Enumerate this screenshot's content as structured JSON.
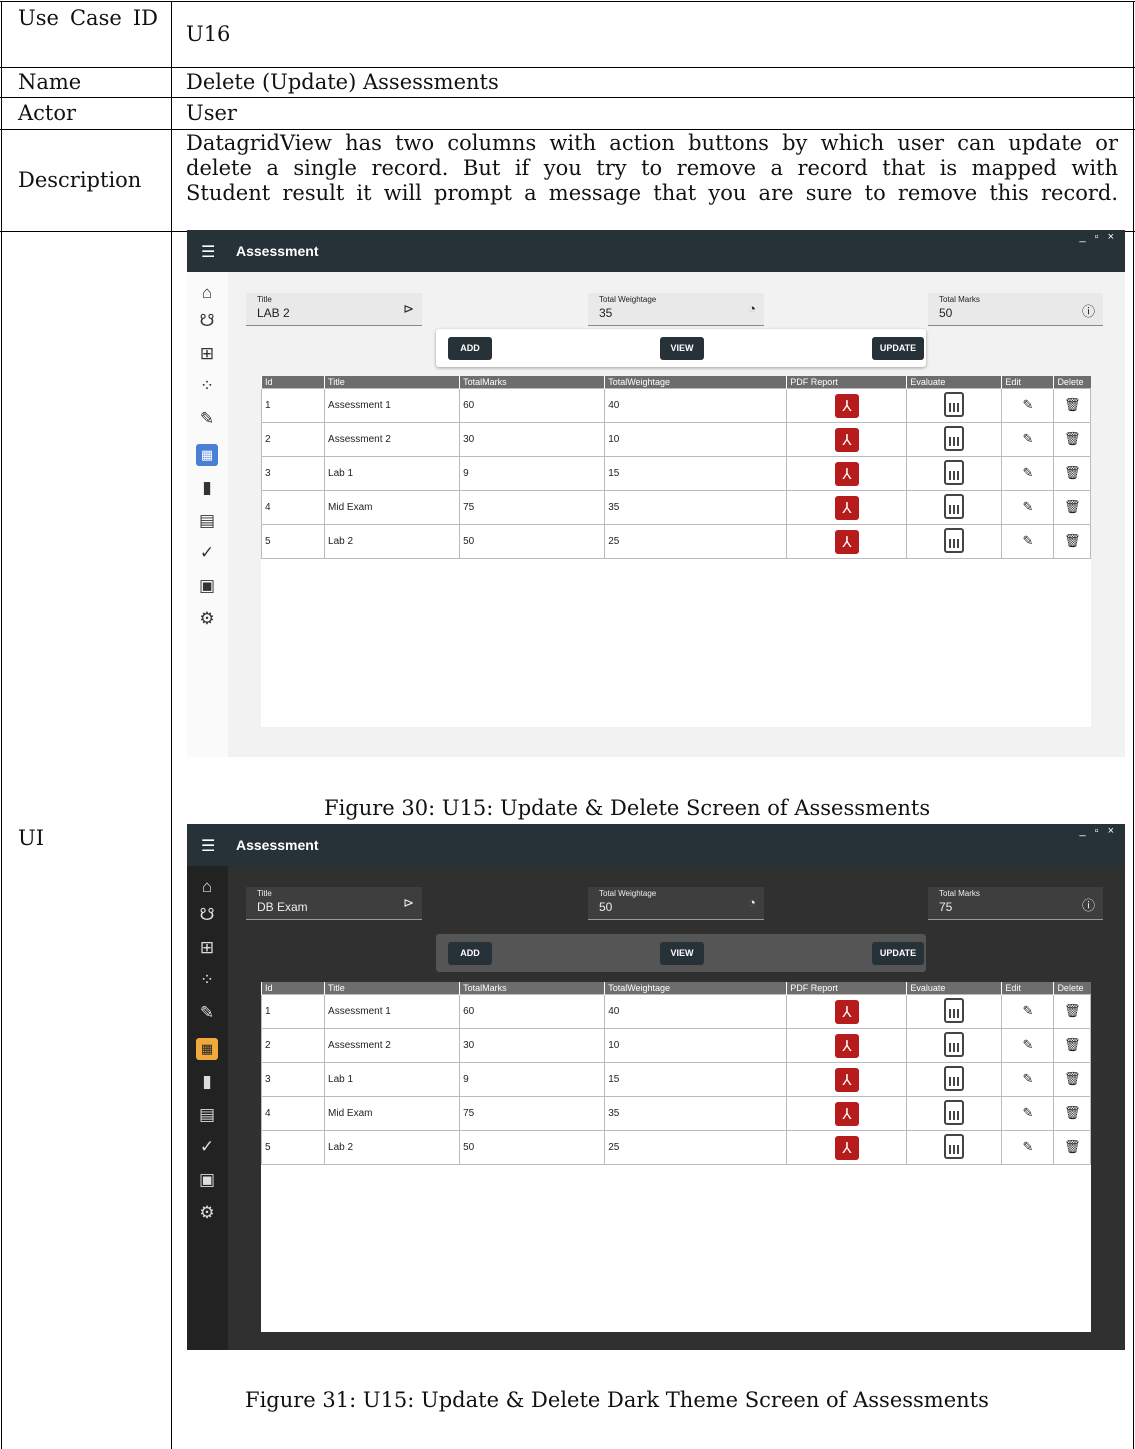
{
  "table": {
    "use_case_id_label": "Use Case ID",
    "use_case_id_value": "U16",
    "name_label": "Name",
    "name_value": "Delete (Update) Assessments",
    "actor_label": "Actor",
    "actor_value": "User",
    "description_label": "Description",
    "description_lines": [
      "DatagridView has two columns with action buttons by which user can update or",
      "delete a single record. But if you try to remove a record that is mapped with",
      "Student result it will prompt a message that you are sure to remove this record."
    ],
    "ui_label": "UI"
  },
  "figures": [
    {
      "caption": "Figure 30: U15: Update & Delete Screen of Assessments",
      "theme": "light",
      "accent": "#4a7fd6"
    },
    {
      "caption": "Figure 31: U15: Update & Delete Dark Theme Screen of Assessments",
      "theme": "dark",
      "accent": "#f2a93b"
    }
  ],
  "app": {
    "title": "Assessment",
    "menu_icon": "hamburger-icon",
    "window_controls": "_ ▫ ×",
    "sidebar_icons": [
      "home-icon",
      "graduation-cap-icon",
      "hierarchy-icon",
      "scatter-icon",
      "ruler-icon",
      "assessment-table-icon",
      "book-icon",
      "calculator-icon",
      "checklist-icon",
      "pdf-icon",
      "gear-icon"
    ],
    "fields": {
      "title_label": "Title",
      "weightage_label": "Total Weightage",
      "marks_label": "Total Marks"
    },
    "buttons": {
      "add": "ADD",
      "view": "VIEW",
      "update": "UPDATE"
    },
    "columns": [
      "Id",
      "Title",
      "TotalMarks",
      "TotalWeightage",
      "PDF Report",
      "Evaluate",
      "Edit",
      "Delete"
    ],
    "rows": [
      {
        "id": "1",
        "title": "Assessment 1",
        "marks": "60",
        "weightage": "40"
      },
      {
        "id": "2",
        "title": "Assessment 2",
        "marks": "30",
        "weightage": "10"
      },
      {
        "id": "3",
        "title": "Lab 1",
        "marks": "9",
        "weightage": "15"
      },
      {
        "id": "4",
        "title": "Mid Exam",
        "marks": "75",
        "weightage": "35"
      },
      {
        "id": "5",
        "title": "Lab 2",
        "marks": "50",
        "weightage": "25"
      }
    ]
  },
  "light_values": {
    "title": "LAB 2",
    "weightage": "35",
    "marks": "50"
  },
  "dark_values": {
    "title": "DB Exam",
    "weightage": "50",
    "marks": "75"
  },
  "brand": {
    "titlebar": "#263238",
    "pdf_red": "#b71c1c"
  }
}
